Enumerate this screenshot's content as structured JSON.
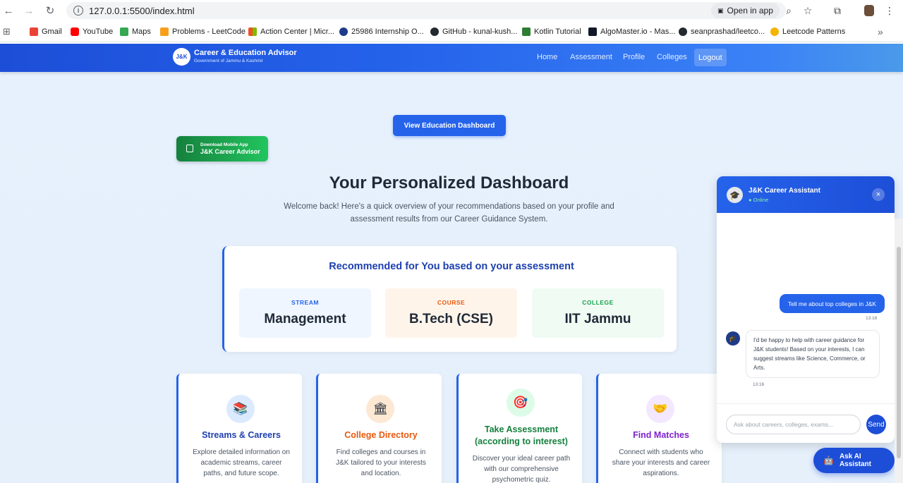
{
  "browser": {
    "url": "127.0.0.1:5500/index.html",
    "open_in_app": "Open in app",
    "bookmarks": [
      {
        "label": "Gmail",
        "color": "#ea4335"
      },
      {
        "label": "YouTube",
        "color": "#ff0000"
      },
      {
        "label": "Maps",
        "color": "#34a853"
      },
      {
        "label": "Problems - LeetCode",
        "color": "#f89f1b"
      },
      {
        "label": "Action Center | Micr...",
        "color": "#0078d4"
      },
      {
        "label": "25986 Internship O...",
        "color": "#1e3a8a"
      },
      {
        "label": "GitHub - kunal-kush...",
        "color": "#24292e"
      },
      {
        "label": "Kotlin Tutorial",
        "color": "#2e7d32"
      },
      {
        "label": "AlgoMaster.io - Mas...",
        "color": "#111827"
      },
      {
        "label": "seanprashad/leetco...",
        "color": "#24292e"
      },
      {
        "label": "Leetcode Patterns",
        "color": "#f5b400"
      }
    ]
  },
  "navbar": {
    "logo_text": "J&K",
    "title": "Career & Education Advisor",
    "subtitle": "Government of Jammu & Kashmir",
    "links": [
      "Home",
      "Assessment",
      "Profile",
      "Colleges"
    ],
    "logout": "Logout"
  },
  "hero": {
    "view_button": "View Education Dashboard",
    "download_small": "Download Mobile App",
    "download_big": "J&K Career Advisor"
  },
  "dashboard": {
    "title": "Your Personalized Dashboard",
    "description": "Welcome back! Here's a quick overview of your recommendations based on your profile and assessment results from our Career Guidance System."
  },
  "recommendations": {
    "title": "Recommended for You based on your assessment",
    "items": [
      {
        "label": "STREAM",
        "value": "Management",
        "color": "#2563eb",
        "bg": "#eff6ff"
      },
      {
        "label": "COURSE",
        "value": "B.Tech (CSE)",
        "color": "#ea580c",
        "bg": "#fff4ea"
      },
      {
        "label": "COLLEGE",
        "value": "IIT Jammu",
        "color": "#16a34a",
        "bg": "#effbf3"
      }
    ]
  },
  "features": [
    {
      "icon": "📚",
      "icon_name": "books-icon",
      "title": "Streams & Careers",
      "desc": "Explore detailed information on academic streams, career paths, and future scope.",
      "color": "#1e40af",
      "icon_bg": "#dbeafe"
    },
    {
      "icon": "🏛",
      "icon_name": "building-icon",
      "title": "College Directory",
      "desc": "Find colleges and courses in J&K tailored to your interests and location.",
      "color": "#ea580c",
      "icon_bg": "#fde8d3"
    },
    {
      "icon": "🎯",
      "icon_name": "target-icon",
      "title": "Take Assessment (according to interest)",
      "desc": "Discover your ideal career path with our comprehensive psychometric quiz.",
      "color": "#15803d",
      "icon_bg": "#dcfce7"
    },
    {
      "icon": "🤝",
      "icon_name": "handshake-icon",
      "title": "Find Matches",
      "desc": "Connect with students who share your interests and career aspirations.",
      "color": "#7e22ce",
      "icon_bg": "#f3e8ff"
    }
  ],
  "chat": {
    "title": "J&K Career Assistant",
    "status": "● Online",
    "user_message": "Tell me about top colleges in J&K",
    "user_time": "13:16",
    "bot_message": "I'd be happy to help with career guidance for J&K students! Based on your interests, I can suggest streams like Science, Commerce, or Arts.",
    "bot_time": "13:16",
    "input_placeholder": "Ask about careers, colleges, exams...",
    "send_label": "Send",
    "ask_ai_label": "Ask AI Assistant"
  }
}
